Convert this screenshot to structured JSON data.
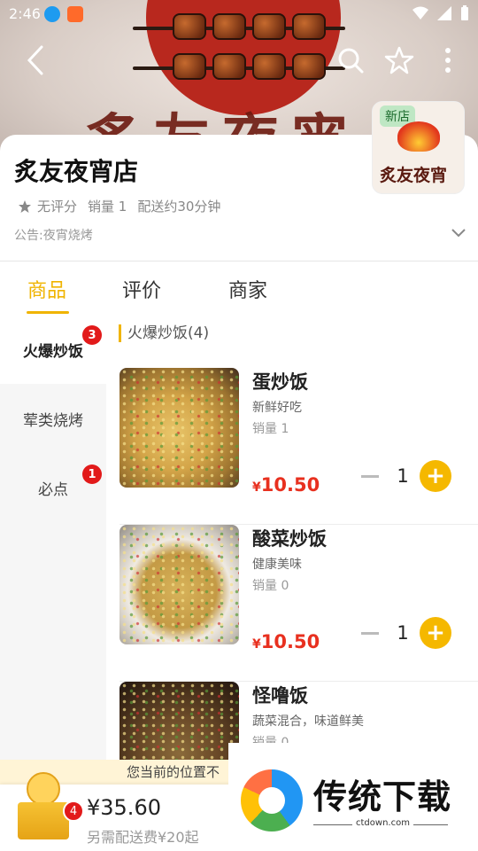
{
  "status_bar": {
    "time": "2:46"
  },
  "banner": {
    "image_text": "炙友夜宵"
  },
  "store": {
    "name": "炙友夜宵店",
    "rating": "无评分",
    "sales": "销量 1",
    "delivery_time": "配送约30分钟",
    "notice": "公告:夜宵烧烤",
    "logo_badge": "新店",
    "logo_text": "炙友夜宵"
  },
  "tabs": [
    {
      "label": "商品",
      "active": true
    },
    {
      "label": "评价",
      "active": false
    },
    {
      "label": "商家",
      "active": false
    }
  ],
  "categories": [
    {
      "label": "火爆炒饭",
      "badge": "3",
      "active": true
    },
    {
      "label": "荤类烧烤",
      "badge": "",
      "active": false
    },
    {
      "label": "必点",
      "badge": "1",
      "active": false
    }
  ],
  "section": {
    "title": "火爆炒饭(4)"
  },
  "products": [
    {
      "name": "蛋炒饭",
      "desc": "新鲜好吃",
      "sales": "销量 1",
      "currency": "¥",
      "price": "10.50",
      "qty": "1"
    },
    {
      "name": "酸菜炒饭",
      "desc": "健康美味",
      "sales": "销量 0",
      "currency": "¥",
      "price": "10.50",
      "qty": "1"
    },
    {
      "name": "怪噜饭",
      "desc": "蔬菜混合，味道鲜美",
      "sales": "销量 0"
    }
  ],
  "location_bar": {
    "text": "您当前的位置不"
  },
  "cart": {
    "count": "4",
    "total": "¥35.60",
    "delivery_note": "另需配送费¥20起"
  },
  "watermark": {
    "text": "传统下载",
    "url": "ctdown.com"
  },
  "colors": {
    "accent": "#f0b400",
    "price": "#e8301f",
    "badge": "#e21a1a"
  }
}
